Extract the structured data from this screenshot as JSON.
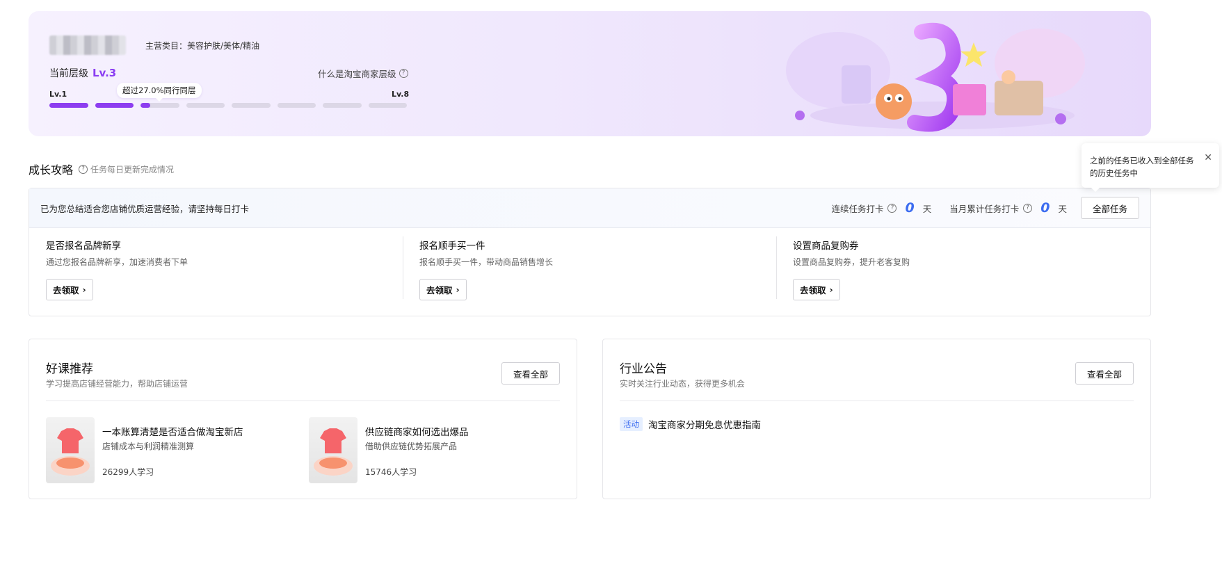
{
  "hero": {
    "category": "主营类目：美容护肤/美体/精油",
    "level_label": "当前层级",
    "level_value": "Lv.3",
    "what_level": "什么是淘宝商家层级",
    "lv_min": "Lv.1",
    "lv_max": "Lv.8",
    "bubble": "超过27.0%同行同层",
    "current_level_progress": 0.25
  },
  "growth": {
    "title": "成长攻略",
    "hint": "任务每日更新完成情况",
    "banner": "已为您总结适合您店铺优质运营经验，请坚持每日打卡",
    "streak_label": "连续任务打卡",
    "streak_value": "0",
    "month_label": "当月累计任务打卡",
    "month_value": "0",
    "day_unit": "天",
    "all_tasks": "全部任务",
    "tooltip": "之前的任务已收入到全部任务的历史任务中",
    "tasks": [
      {
        "title": "是否报名品牌新享",
        "desc": "通过您报名品牌新享，加速消费者下单",
        "button": "去领取"
      },
      {
        "title": "报名顺手买一件",
        "desc": "报名顺手买一件，带动商品销售增长",
        "button": "去领取"
      },
      {
        "title": "设置商品复购券",
        "desc": "设置商品复购券，提升老客复购",
        "button": "去领取"
      }
    ]
  },
  "courses": {
    "title": "好课推荐",
    "subtitle": "学习提高店铺经营能力，帮助店铺运营",
    "view_all": "查看全部",
    "items": [
      {
        "title": "一本账算清楚是否适合做淘宝新店",
        "desc": "店铺成本与利润精准测算",
        "students": "26299人学习"
      },
      {
        "title": "供应链商家如何选出爆品",
        "desc": "借助供应链优势拓展产品",
        "students": "15746人学习"
      }
    ]
  },
  "notices": {
    "title": "行业公告",
    "subtitle": "实时关注行业动态，获得更多机会",
    "view_all": "查看全部",
    "items": [
      {
        "tag": "活动",
        "title": "淘宝商家分期免息优惠指南"
      }
    ]
  },
  "colors": {
    "accent_purple": "#8d3df0",
    "accent_blue": "#3d6df0"
  }
}
